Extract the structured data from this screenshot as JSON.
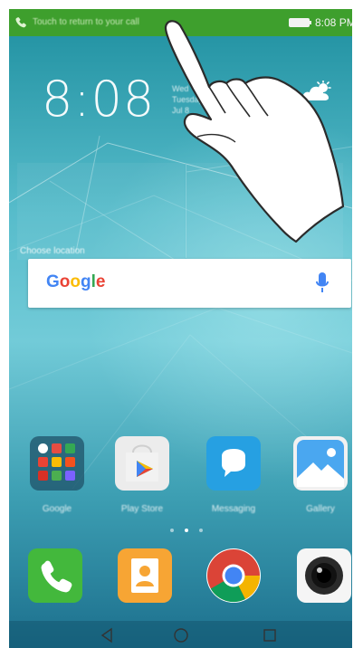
{
  "status_bar": {
    "notification_text": "Touch to return to your call",
    "time": "8:08 PM",
    "phone_icon": "phone-icon",
    "battery_icon": "battery-icon",
    "background_color": "#3e9f2d"
  },
  "clock_widget": {
    "time": "8:08",
    "date_lines": [
      "Wed",
      "Tuesday",
      "Jul 8"
    ],
    "weather_icon": "partly-cloudy-icon",
    "location": "Choose location"
  },
  "search": {
    "logo": "Google",
    "mic_icon": "microphone-icon"
  },
  "apps": [
    {
      "label": "Google",
      "icon": "google-folder-icon",
      "color": "#245c73"
    },
    {
      "label": "Play Store",
      "icon": "play-store-icon",
      "color": "#e8e8e8"
    },
    {
      "label": "Messaging",
      "icon": "message-icon",
      "color": "#26a0e2"
    },
    {
      "label": "Gallery",
      "icon": "gallery-icon",
      "color": "#f1f1f1"
    }
  ],
  "page_indicator": {
    "pages": 3,
    "active": 2
  },
  "dock": [
    {
      "icon": "phone-call-icon",
      "color": "#43b83c"
    },
    {
      "icon": "contacts-icon",
      "color": "#f7a534"
    },
    {
      "icon": "chrome-icon",
      "color": "#ffffff"
    },
    {
      "icon": "camera-icon",
      "color": "#f5f5f5"
    }
  ],
  "nav": {
    "back_icon": "back-icon",
    "home_icon": "home-icon",
    "recents_icon": "recents-icon"
  },
  "overlay": {
    "hand_icon": "pointing-hand-icon"
  }
}
